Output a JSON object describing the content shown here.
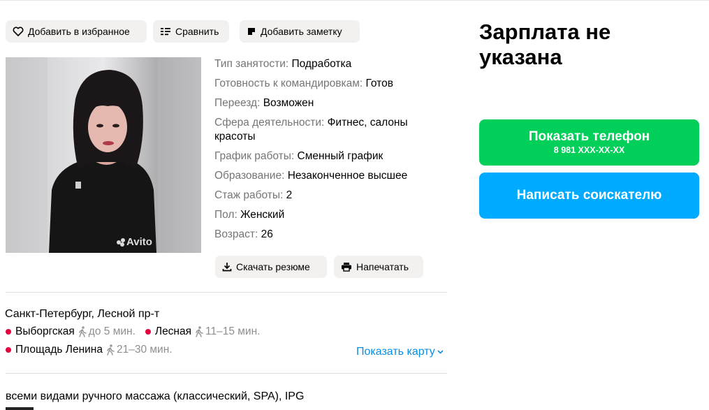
{
  "toolbar": {
    "favorite_label": "Добавить в избранное",
    "compare_label": "Сравнить",
    "note_label": "Добавить заметку"
  },
  "photo": {
    "watermark": "Avito",
    "icon": "person-photo"
  },
  "params": [
    {
      "key": "Тип занятости:",
      "value": "Подработка"
    },
    {
      "key": "Готовность к командировкам:",
      "value": "Готов"
    },
    {
      "key": "Переезд:",
      "value": "Возможен"
    },
    {
      "key": "Сфера деятельности:",
      "value": "Фитнес, салоны красоты"
    },
    {
      "key": "График работы:",
      "value": "Сменный график"
    },
    {
      "key": "Образование:",
      "value": "Незаконченное высшее"
    },
    {
      "key": "Стаж работы:",
      "value": "2"
    },
    {
      "key": "Пол:",
      "value": "Женский"
    },
    {
      "key": "Возраст:",
      "value": "26"
    }
  ],
  "actions": {
    "download_label": "Скачать резюме",
    "print_label": "Напечатать"
  },
  "location": {
    "address": "Санкт-Петербург, Лесной пр-т",
    "metro": [
      {
        "name": "Выборгская",
        "time": "до 5 мин."
      },
      {
        "name": "Лесная",
        "time": "11–15 мин."
      },
      {
        "name": "Площадь Ленина",
        "time": "21–30 мин."
      }
    ],
    "show_map_label": "Показать карту",
    "metro_color": "#e4003b"
  },
  "description": {
    "line1": "всеми видами ручного массажа (классический, SPA), IPG"
  },
  "sidebar": {
    "salary": "Зарплата не указана",
    "show_phone_label": "Показать телефон",
    "phone_masked": "8 981 XXX-XX-XX",
    "write_label": "Написать соискателю",
    "green": "#00cf5a",
    "blue": "#00aaff"
  }
}
